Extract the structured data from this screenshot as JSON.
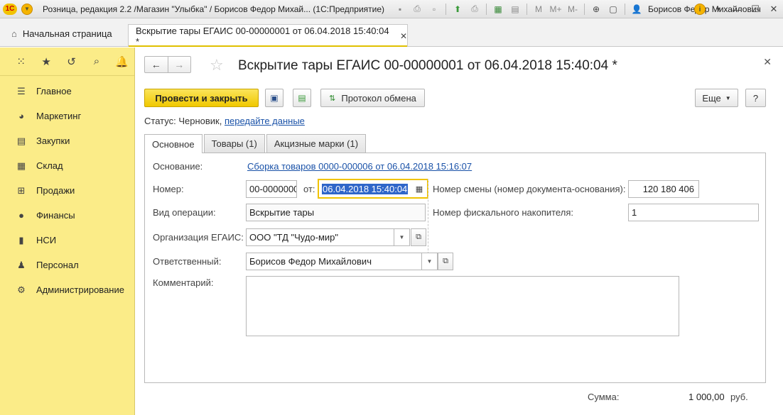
{
  "window": {
    "app_title": "Розница, редакция 2.2 /Магазин \"Улыбка\" / Борисов Федор Михай... (1С:Предприятие)",
    "user": "Борисов Федор Михайлович",
    "toolbar_icons": [
      "save-icon",
      "print-icon",
      "preview-icon",
      "upload-icon",
      "print2-icon",
      "calculator-icon",
      "calendar-icon",
      "m-icon",
      "m-plus-icon",
      "m-minus-icon",
      "zoom-icon",
      "window-icon"
    ],
    "m_labels": {
      "m": "M",
      "m_plus": "M+",
      "m_minus": "M-"
    },
    "info_label": "i"
  },
  "tabs_bar": {
    "home_label": "Начальная страница",
    "doc_tab_label": "Вскрытие тары ЕГАИС 00-00000001 от 06.04.2018 15:40:04 *"
  },
  "sidebar": {
    "items": [
      {
        "label": "Главное",
        "icon": "menu-icon"
      },
      {
        "label": "Маркетинг",
        "icon": "pie-chart-icon"
      },
      {
        "label": "Закупки",
        "icon": "cart-icon"
      },
      {
        "label": "Склад",
        "icon": "warehouse-icon"
      },
      {
        "label": "Продажи",
        "icon": "basket-icon"
      },
      {
        "label": "Финансы",
        "icon": "ruble-icon"
      },
      {
        "label": "НСИ",
        "icon": "reference-icon"
      },
      {
        "label": "Персонал",
        "icon": "person-icon"
      },
      {
        "label": "Администрирование",
        "icon": "gear-icon"
      }
    ]
  },
  "form": {
    "title": "Вскрытие тары ЕГАИС 00-00000001 от 06.04.2018 15:40:04 *",
    "buttons": {
      "post_close": "Провести и закрыть",
      "exchange_log": "Протокол обмена",
      "more": "Еще",
      "help": "?"
    },
    "status": {
      "label": "Статус:",
      "value": "Черновик,",
      "link": "передайте данные"
    },
    "tabs": [
      "Основное",
      "Товары (1)",
      "Акцизные марки (1)"
    ],
    "fields": {
      "basis_label": "Основание:",
      "basis_link": "Сборка товаров 0000-000006 от 06.04.2018 15:16:07",
      "number_label": "Номер:",
      "number_value": "00-0000000",
      "from_label": "от:",
      "date_value": "06.04.2018 15:40:04",
      "shift_label": "Номер смены (номер документа-основания):",
      "shift_value": "120 180 406",
      "op_label": "Вид операции:",
      "op_value": "Вскрытие тары",
      "fiscal_label": "Номер фискального накопителя:",
      "fiscal_value": "1",
      "org_label": "Организация ЕГАИС:",
      "org_value": "ООО \"ТД \"Чудо-мир\"",
      "resp_label": "Ответственный:",
      "resp_value": "Борисов Федор Михайлович",
      "comment_label": "Комментарий:",
      "comment_value": ""
    },
    "total": {
      "label": "Сумма:",
      "value": "1 000,00",
      "currency": "руб."
    }
  }
}
